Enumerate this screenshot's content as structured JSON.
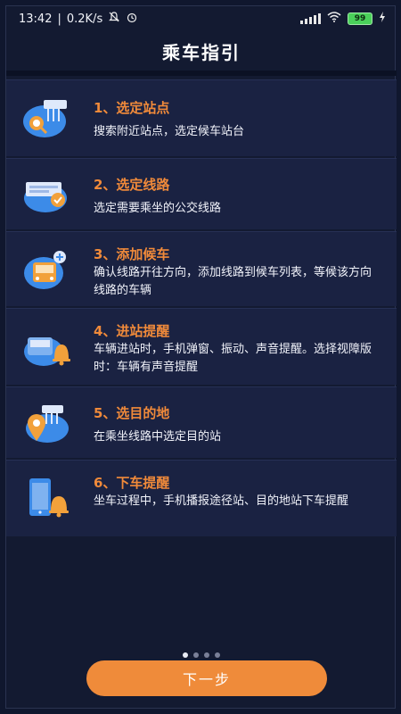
{
  "status_bar": {
    "time": "13:42",
    "speed": "0.2K/s",
    "battery": "99"
  },
  "page": {
    "title": "乘车指引"
  },
  "steps": [
    {
      "title": "1、选定站点",
      "desc": "搜索附近站点，选定候车站台",
      "icon": "station-search-icon"
    },
    {
      "title": "2、选定线路",
      "desc": "选定需要乘坐的公交线路",
      "icon": "route-card-icon"
    },
    {
      "title": "3、添加候车",
      "desc": "确认线路开往方向，添加线路到候车列表，等候该方向线路的车辆",
      "icon": "bus-add-icon"
    },
    {
      "title": "4、进站提醒",
      "desc": "车辆进站时，手机弹窗、振动、声音提醒。选择视障版时：车辆有声音提醒",
      "icon": "arrival-bell-icon"
    },
    {
      "title": "5、选目的地",
      "desc": "在乘坐线路中选定目的站",
      "icon": "destination-pin-icon"
    },
    {
      "title": "6、下车提醒",
      "desc": "坐车过程中，手机播报途径站、目的地站下车提醒",
      "icon": "phone-bell-icon"
    }
  ],
  "pager": {
    "count": 4,
    "active": 0
  },
  "next_button": {
    "label": "下一步"
  },
  "colors": {
    "accent": "#ef8b3a",
    "background": "#131a31",
    "card": "#1a2242",
    "icon_blue": "#3c8be8"
  }
}
